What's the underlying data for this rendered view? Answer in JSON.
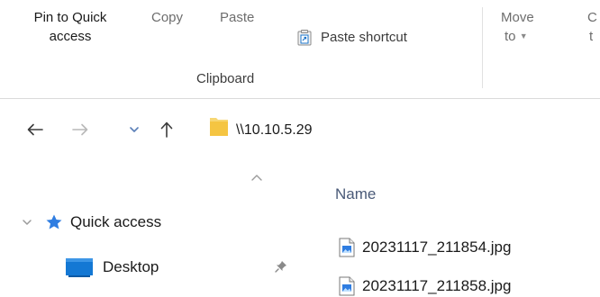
{
  "ribbon": {
    "pin_to_quick_access_line1": "Pin to Quick",
    "pin_to_quick_access_line2": "access",
    "copy_label": "Copy",
    "paste_label": "Paste",
    "paste_shortcut_label": "Paste shortcut",
    "clipboard_group_label": "Clipboard",
    "move_to_line1": "Move",
    "move_to_line2": "to",
    "copy_to_line1_partial": "C",
    "copy_to_line2_partial": "t"
  },
  "address": {
    "path": "\\\\10.10.5.29"
  },
  "nav": {
    "quick_access_label": "Quick access",
    "desktop_label": "Desktop"
  },
  "files": {
    "column_name": "Name",
    "items": [
      {
        "name": "20231117_211854.jpg"
      },
      {
        "name": "20231117_211858.jpg"
      }
    ]
  },
  "colors": {
    "accent_blue": "#1a73c9",
    "folder_yellow": "#f5c542",
    "star_blue": "#2f7de1",
    "desktop_blue": "#1478d4"
  },
  "icons": {
    "back": "back-arrow-icon",
    "forward": "forward-arrow-icon",
    "recent": "recent-locations-chevron-icon",
    "up": "up-arrow-icon",
    "folder": "folder-icon",
    "star": "star-icon",
    "desktop": "desktop-icon",
    "pin": "pin-icon",
    "image_file": "image-file-icon",
    "paste_shortcut": "paste-shortcut-icon",
    "sort_caret": "sort-ascending-caret-icon"
  }
}
